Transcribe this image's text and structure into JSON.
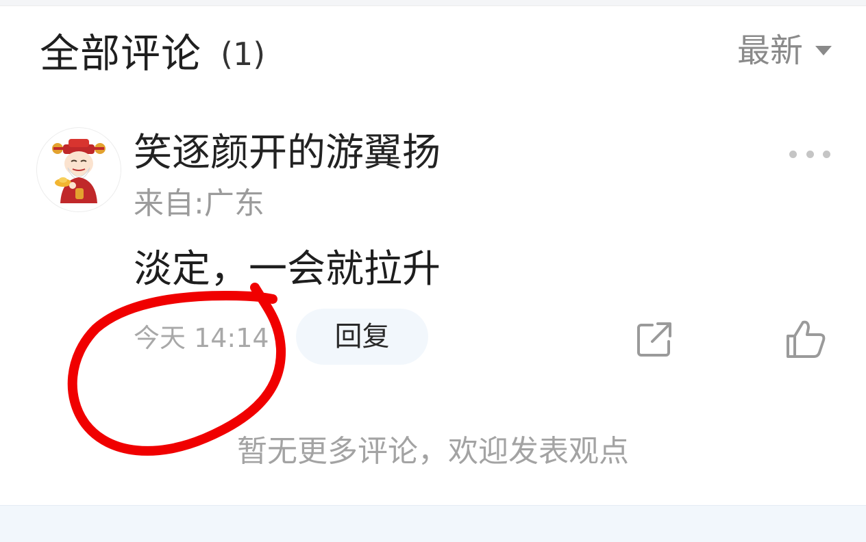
{
  "header": {
    "title": "全部评论",
    "count": "(1)",
    "sort_label": "最新",
    "sort_icon": "caret-down-icon"
  },
  "comment": {
    "avatar_icon": "caishen-avatar-icon",
    "username": "笑逐颜开的游翼扬",
    "location": "来自:广东",
    "text": "淡定，一会就拉升",
    "timestamp": "今天 14:14",
    "reply_label": "回复",
    "more_icon": "more-dots-icon",
    "share_icon": "share-icon",
    "like_icon": "thumbs-up-icon"
  },
  "footer": {
    "no_more_text": "暂无更多评论，欢迎发表观点"
  },
  "colors": {
    "annotation": "#f00000",
    "reply_bg": "#f2f7fc",
    "muted_text": "#a8a8a8"
  }
}
